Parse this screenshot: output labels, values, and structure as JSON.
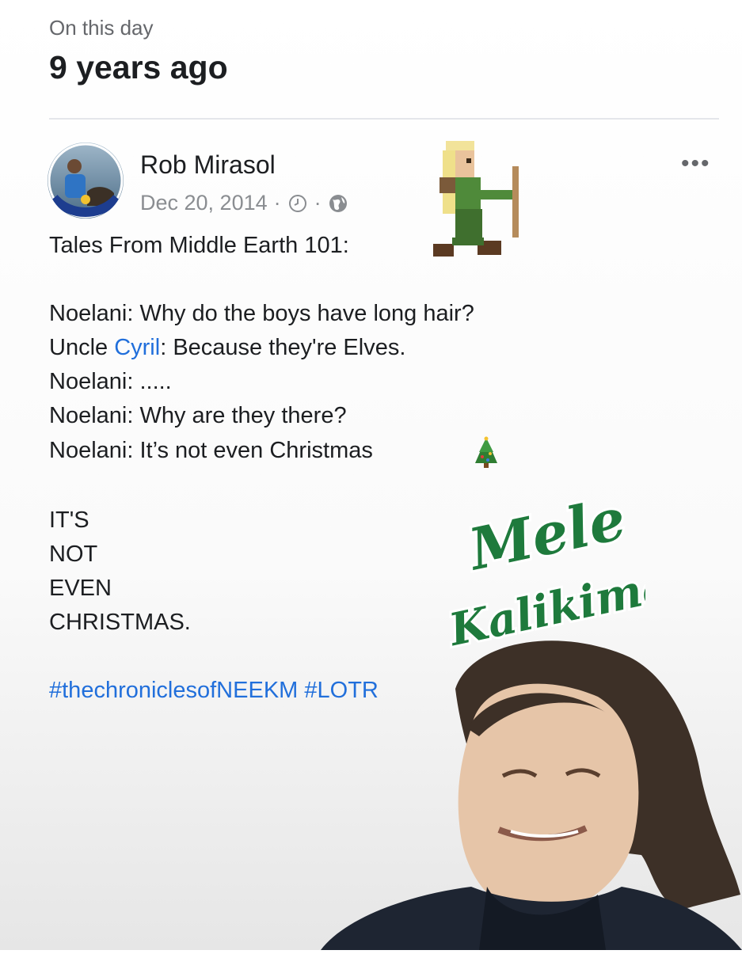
{
  "memory": {
    "label": "On this day",
    "title": "9 years ago"
  },
  "post": {
    "author": "Rob Mirasol",
    "date": "Dec 20, 2014",
    "separator": "·",
    "more_icon": "more-dots-icon",
    "time_icon": "clock-icon",
    "privacy_icon": "globe-icon",
    "lines": {
      "heading": "Tales From Middle Earth 101:",
      "l1": "Noelani: Why do the boys have long hair?",
      "l2_prefix": "Uncle ",
      "l2_mention": "Cyril",
      "l2_suffix": ": Because they're Elves.",
      "l3": "Noelani: .....",
      "l4": "Noelani: Why are they there?",
      "l5": "Noelani: It’s not even Christmas",
      "caps1": "IT'S",
      "caps2": "NOT",
      "caps3": "EVEN",
      "caps4": "CHRISTMAS."
    },
    "hashtags": [
      "#thechroniclesofNEEKM",
      "#LOTR"
    ],
    "link_color": "#216fdb"
  },
  "stickers": {
    "mele_line1": "Mele",
    "mele_line2": "Kalikimaka",
    "mele_color": "#1e7a3c",
    "elf_icon": "pixel-elf-archer-icon",
    "tree_icon": "christmas-tree-icon"
  }
}
